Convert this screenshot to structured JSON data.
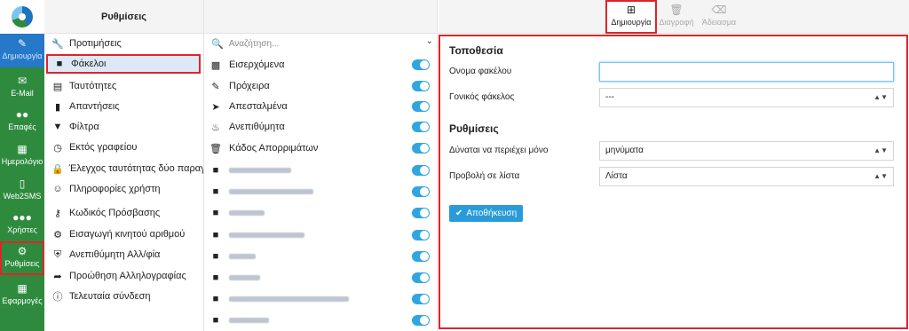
{
  "nav": {
    "items": [
      {
        "label": "Δημιουργία",
        "icon": "compose-icon"
      },
      {
        "label": "E-Mail",
        "icon": "envelope-icon"
      },
      {
        "label": "Επαφές",
        "icon": "contacts-icon"
      },
      {
        "label": "Ημερολόγιο",
        "icon": "calendar-icon"
      },
      {
        "label": "Web2SMS",
        "icon": "mobile-icon"
      },
      {
        "label": "Χρήστες",
        "icon": "users-icon"
      },
      {
        "label": "Ρυθμίσεις",
        "icon": "gear-icon"
      },
      {
        "label": "Εφαρμογές",
        "icon": "apps-grid-icon"
      }
    ]
  },
  "settings": {
    "title": "Ρυθμίσεις",
    "items": [
      {
        "label": "Προτιμήσεις",
        "icon": "wrench-icon"
      },
      {
        "label": "Φάκελοι",
        "icon": "folder-icon"
      },
      {
        "label": "Ταυτότητες",
        "icon": "id-card-icon"
      },
      {
        "label": "Απαντήσεις",
        "icon": "bookmark-icon"
      },
      {
        "label": "Φίλτρα",
        "icon": "filter-icon"
      },
      {
        "label": "Εκτός γραφείου",
        "icon": "clock-icon"
      },
      {
        "label": "Έλεγχος ταυτότητας δύο παραγόντων",
        "icon": "lock-icon"
      },
      {
        "label": "Πληροφορίες χρήστη",
        "icon": "user-circle-icon"
      },
      {
        "label": "Κωδικός Πρόσβασης",
        "icon": "key-icon"
      },
      {
        "label": "Εισαγωγή κινητού αριθμού",
        "icon": "gear-icon"
      },
      {
        "label": "Ανεπιθύμητη Αλλ/φία",
        "icon": "shield-icon"
      },
      {
        "label": "Προώθηση Αλληλογραφίας",
        "icon": "forward-arrow-icon"
      },
      {
        "label": "Τελευταία σύνδεση",
        "icon": "info-icon"
      }
    ]
  },
  "folders": {
    "search_placeholder": "Αναζήτηση...",
    "items": [
      {
        "label": "Εισερχόμενα",
        "icon": "inbox-icon"
      },
      {
        "label": "Πρόχειρα",
        "icon": "pencil-icon"
      },
      {
        "label": "Απεσταλμένα",
        "icon": "paper-plane-icon"
      },
      {
        "label": "Ανεπιθύμητα",
        "icon": "flame-icon"
      },
      {
        "label": "Κάδος Απορριμάτων",
        "icon": "trash-icon"
      }
    ]
  },
  "toolbar": {
    "create": "Δημιουργία",
    "delete": "Διαγραφή",
    "empty": "Άδειασμα"
  },
  "form": {
    "location_title": "Τοποθεσία",
    "folder_name_label": "Ονομα φακέλου",
    "folder_name_value": "",
    "parent_label": "Γονικός φάκελος",
    "parent_value": "---",
    "settings_title": "Ρυθμίσεις",
    "contains_label": "Δύναται να περιέχει μόνο",
    "contains_value": "μηνύματα",
    "view_label": "Προβολή σε λίστα",
    "view_value": "Λίστα",
    "save_label": "Αποθήκευση"
  },
  "colors": {
    "nav_green": "#2e8b3e",
    "accent_blue": "#2a9bd8",
    "highlight_red": "#e0232a"
  }
}
